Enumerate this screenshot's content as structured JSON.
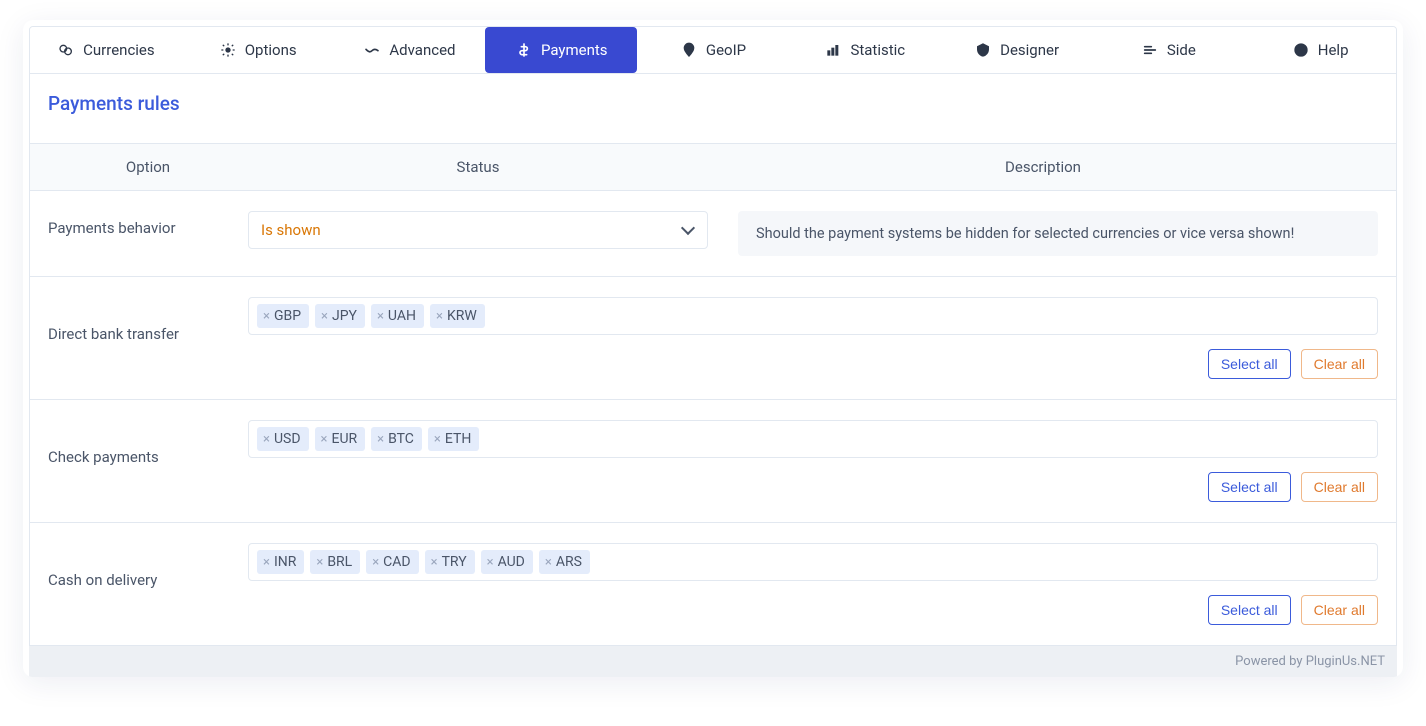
{
  "tabs": [
    {
      "label": "Currencies",
      "icon": "currencies"
    },
    {
      "label": "Options",
      "icon": "options"
    },
    {
      "label": "Advanced",
      "icon": "advanced"
    },
    {
      "label": "Payments",
      "icon": "payments",
      "active": true
    },
    {
      "label": "GeoIP",
      "icon": "geoip"
    },
    {
      "label": "Statistic",
      "icon": "statistic"
    },
    {
      "label": "Designer",
      "icon": "designer"
    },
    {
      "label": "Side",
      "icon": "side"
    },
    {
      "label": "Help",
      "icon": "help"
    }
  ],
  "section_title": "Payments rules",
  "headers": {
    "option": "Option",
    "status": "Status",
    "description": "Description"
  },
  "behavior_row": {
    "label": "Payments behavior",
    "select_value": "Is shown",
    "description": "Should the payment systems be hidden for selected currencies or vice versa shown!"
  },
  "payment_rows": [
    {
      "label": "Direct bank transfer",
      "tags": [
        "GBP",
        "JPY",
        "UAH",
        "KRW"
      ]
    },
    {
      "label": "Check payments",
      "tags": [
        "USD",
        "EUR",
        "BTC",
        "ETH"
      ]
    },
    {
      "label": "Cash on delivery",
      "tags": [
        "INR",
        "BRL",
        "CAD",
        "TRY",
        "AUD",
        "ARS"
      ]
    }
  ],
  "buttons": {
    "select_all": "Select all",
    "clear_all": "Clear all"
  },
  "footer": "Powered by PluginUs.NET"
}
